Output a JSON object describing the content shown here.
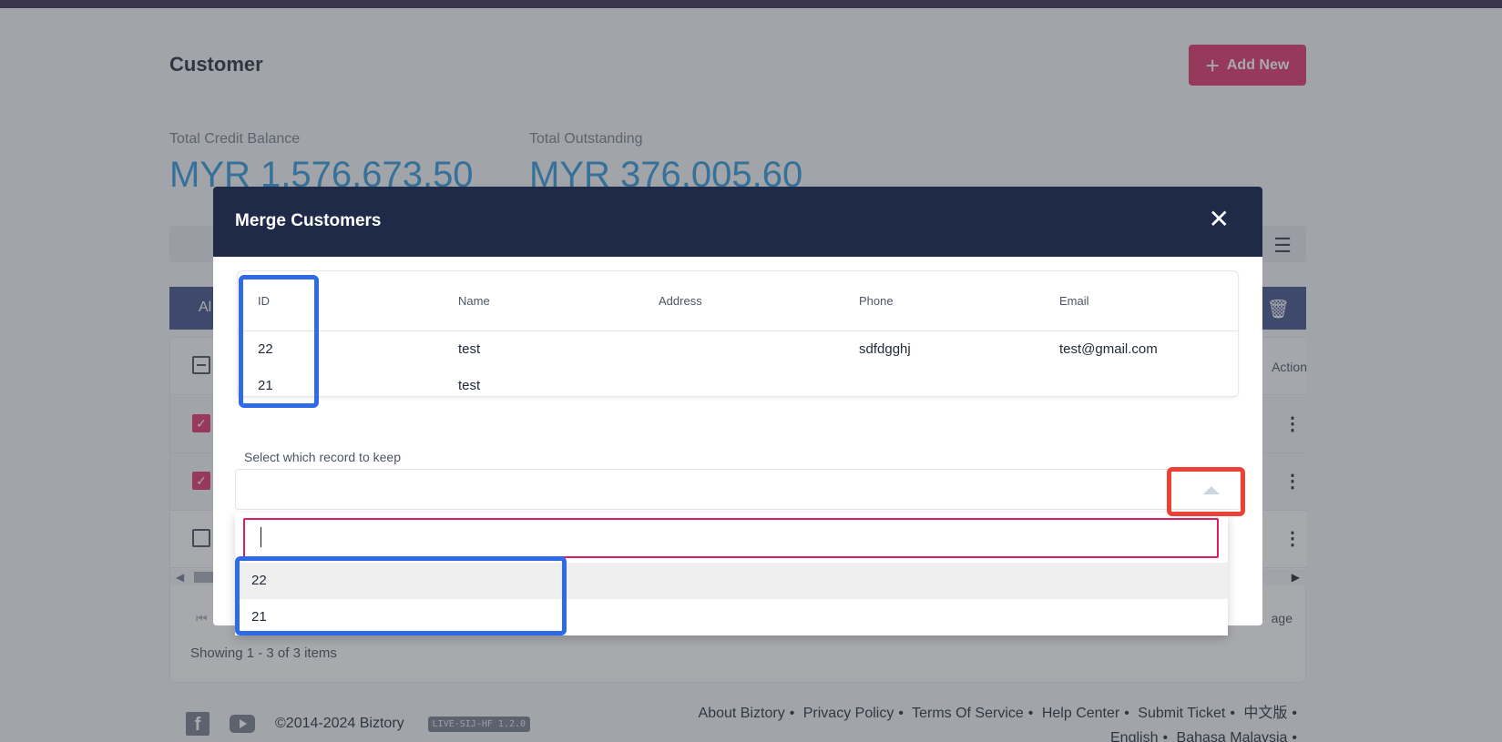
{
  "page": {
    "title": "Customer",
    "add_new_label": "Add New",
    "stats": [
      {
        "label": "Total Credit Balance",
        "value": "MYR 1,576,673.50"
      },
      {
        "label": "Total Outstanding",
        "value": "MYR 376,005.60"
      }
    ],
    "tab_all": "Al",
    "action_header": "Action",
    "per_page": "age",
    "showing": "Showing 1 - 3 of 3 items"
  },
  "footer": {
    "copyright": "©2014-2024 Biztory",
    "version": "LIVE-SIJ-HF 1.2.0",
    "links": [
      "About Biztory",
      "Privacy Policy",
      "Terms Of Service",
      "Help Center",
      "Submit Ticket",
      "中文版",
      "English",
      "Bahasa Malaysia"
    ]
  },
  "modal": {
    "title": "Merge Customers",
    "columns": [
      "ID",
      "Name",
      "Address",
      "Phone",
      "Email"
    ],
    "rows": [
      {
        "id": "22",
        "name": "test",
        "address": "",
        "phone": "sdfdgghj",
        "email": "test@gmail.com"
      },
      {
        "id": "21",
        "name": "test",
        "address": "",
        "phone": "",
        "email": ""
      }
    ],
    "keep_label": "Select which record to keep",
    "keep_value": "",
    "dropdown": {
      "search_value": "",
      "options": [
        "22",
        "21"
      ]
    }
  },
  "colors": {
    "accent": "#dc1e5a",
    "header_navy": "#1f2a48",
    "stat_blue": "#1d8fd6",
    "highlight_blue": "#2f6ae8",
    "highlight_red": "#ea4335"
  }
}
